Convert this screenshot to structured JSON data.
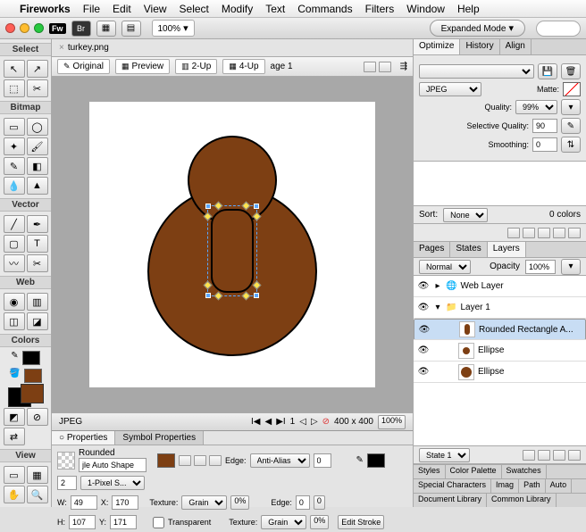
{
  "menubar": {
    "app": "Fireworks",
    "items": [
      "File",
      "Edit",
      "View",
      "Select",
      "Modify",
      "Text",
      "Commands",
      "Filters",
      "Window",
      "Help"
    ]
  },
  "titlebar": {
    "fw": "Fw",
    "br": "Br",
    "zoom": "100%",
    "mode": "Expanded Mode"
  },
  "toolbox": {
    "headers": [
      "Select",
      "Bitmap",
      "Vector",
      "Web",
      "Colors",
      "View"
    ]
  },
  "doc": {
    "filename": "turkey.png",
    "tabs": [
      "Original",
      "Preview",
      "2-Up",
      "4-Up"
    ],
    "page": "age 1",
    "format": "JPEG",
    "nav": {
      "size": "400 x 400",
      "zoom": "100%"
    }
  },
  "props": {
    "tabs": [
      "Properties",
      "Symbol Properties"
    ],
    "shape": "Rounded",
    "subtype": "jle Auto Shape",
    "edge": "Anti-Alias",
    "edge_val": "0",
    "texture": "Grain",
    "texture_pct": "0%",
    "transparent": "Transparent",
    "w": "49",
    "x": "170",
    "h": "107",
    "y": "171",
    "stroke_val": "2",
    "stroke_type": "1-Pixel S...",
    "stroke_edge": "0",
    "stroke_tex": "Grain",
    "stroke_tex_pct": "0%",
    "edit_stroke": "Edit Stroke"
  },
  "optimize": {
    "tabs": [
      "Optimize",
      "History",
      "Align"
    ],
    "format": "JPEG",
    "matte": "Matte:",
    "quality_label": "Quality:",
    "quality": "99%",
    "sel_q_label": "Selective Quality:",
    "sel_q": "90",
    "smooth_label": "Smoothing:",
    "smooth": "0",
    "sort_label": "Sort:",
    "sort": "None",
    "colors": "0 colors"
  },
  "layers": {
    "tabs": [
      "Pages",
      "States",
      "Layers"
    ],
    "blend": "Normal",
    "opacity_label": "Opacity",
    "opacity": "100%",
    "rows": [
      {
        "name": "Web Layer",
        "folder": true,
        "open": false,
        "icon": "web"
      },
      {
        "name": "Layer 1",
        "folder": true,
        "open": true,
        "icon": "folder"
      },
      {
        "name": "Rounded Rectangle A...",
        "sel": true,
        "icon": "r"
      },
      {
        "name": "Ellipse",
        "icon": "c"
      },
      {
        "name": "Ellipse",
        "icon": "c"
      }
    ],
    "state": "State 1"
  },
  "btabs1": [
    "Styles",
    "Color Palette",
    "Swatches"
  ],
  "btabs2": [
    "Special Characters",
    "Imag",
    "Path",
    "Auto"
  ],
  "btabs3": [
    "Document Library",
    "Common Library"
  ]
}
